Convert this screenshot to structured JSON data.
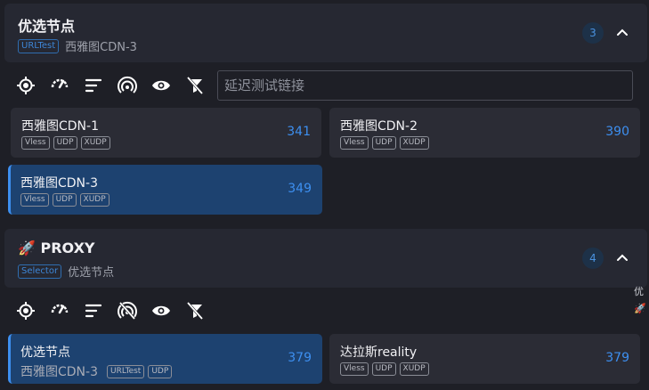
{
  "groups": [
    {
      "title": "优选节点",
      "type": "URLTest",
      "now": "西雅图CDN-3",
      "count": "3",
      "test_placeholder": "延迟测试链接",
      "nodes": [
        {
          "name": "西雅图CDN-1",
          "tags": [
            "Vless",
            "UDP",
            "XUDP"
          ],
          "delay": "341",
          "selected": false
        },
        {
          "name": "西雅图CDN-2",
          "tags": [
            "Vless",
            "UDP",
            "XUDP"
          ],
          "delay": "390",
          "selected": false
        },
        {
          "name": "西雅图CDN-3",
          "tags": [
            "Vless",
            "UDP",
            "XUDP"
          ],
          "delay": "349",
          "selected": true
        }
      ]
    },
    {
      "emoji": "🚀",
      "title": "PROXY",
      "type": "Selector",
      "now": "优选节点",
      "count": "4",
      "nodes": [
        {
          "name": "优选节点",
          "now": "西雅图CDN-3",
          "tags": [
            "URLTest",
            "UDP"
          ],
          "delay": "379",
          "selected": true
        },
        {
          "name": "达拉斯reality",
          "tags": [
            "Vless",
            "UDP",
            "XUDP"
          ],
          "delay": "379",
          "selected": false
        }
      ]
    }
  ],
  "side_nav": [
    "优",
    "🚀"
  ],
  "icons": [
    "locate-icon",
    "speedometer-icon",
    "sort-icon",
    "broadcast-icon",
    "eye-icon",
    "filter-off-icon",
    "chevron-up-icon"
  ],
  "colors": {
    "accent": "#3d8ff0",
    "selected_bg": "#1d4270",
    "card_bg": "#2b2c35",
    "header_bg": "#262832"
  }
}
